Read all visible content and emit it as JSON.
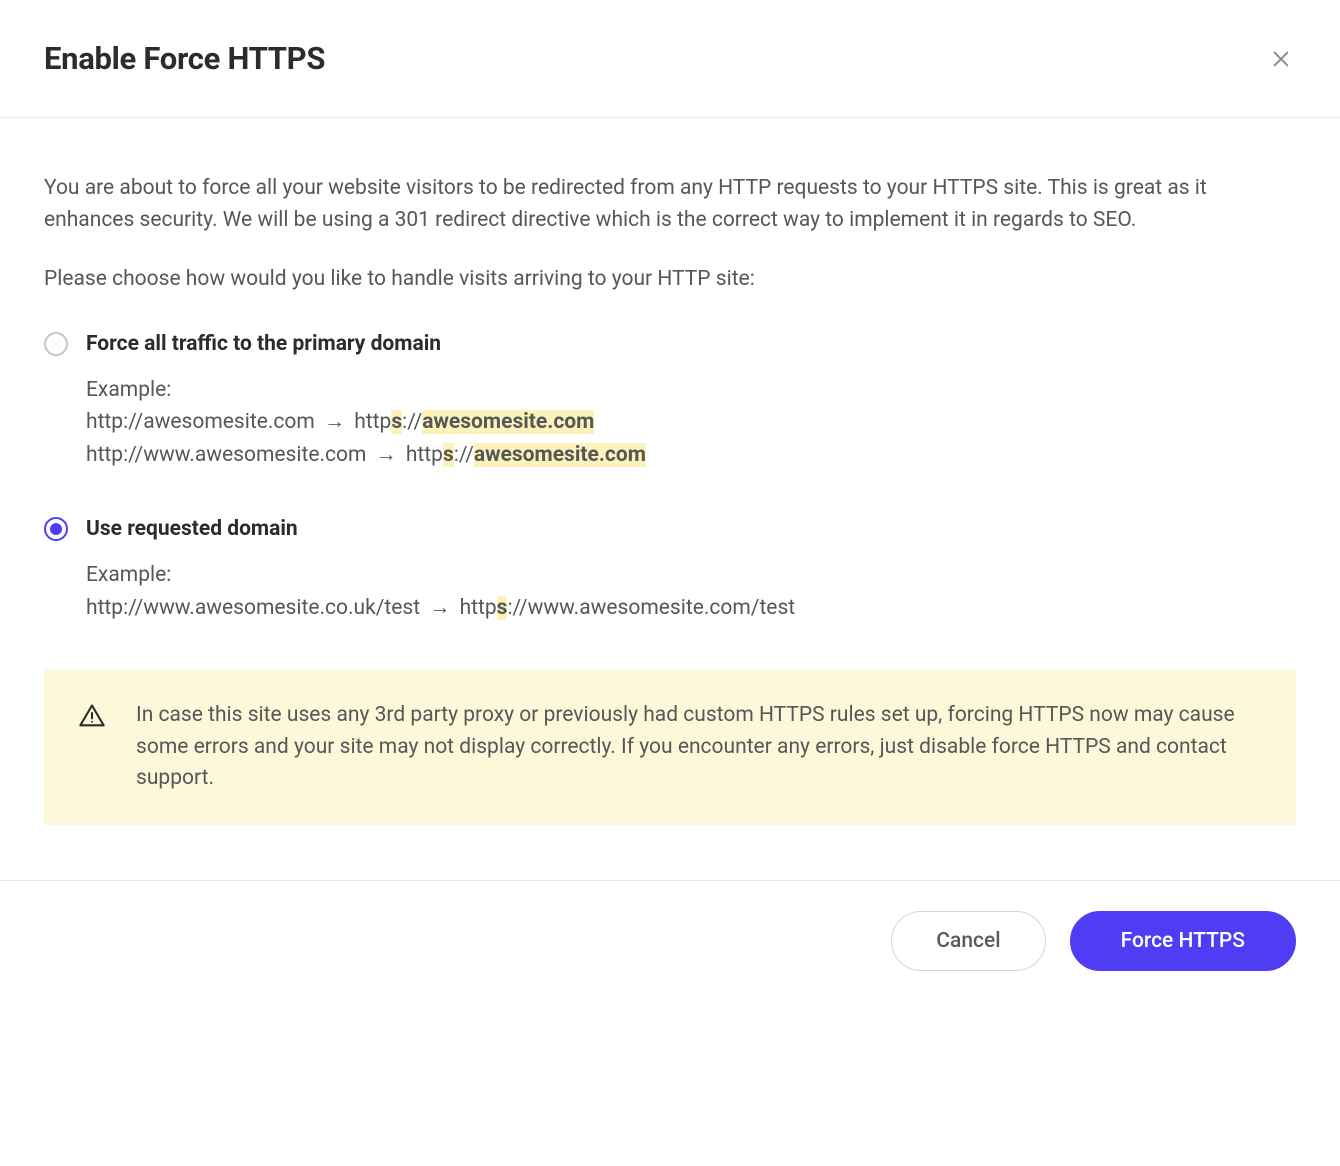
{
  "header": {
    "title": "Enable Force HTTPS"
  },
  "body": {
    "intro": "You are about to force all your website visitors to be redirected from any HTTP requests to your HTTPS site. This is great as it enhances security. We will be using a 301 redirect directive which is the correct way to implement it in regards to SEO.",
    "choose": "Please choose how would you like to handle visits arriving to your HTTP site:",
    "option1": {
      "label": "Force all traffic to the primary domain",
      "example_label": "Example:",
      "line1_from": "http://awesomesite.com",
      "line1_to_prefix": "http",
      "line1_to_s": "s",
      "line1_to_colon": "://",
      "line1_to_domain": "awesomesite.com",
      "line2_from": "http://www.awesomesite.com",
      "line2_to_prefix": "http",
      "line2_to_s": "s",
      "line2_to_colon": "://",
      "line2_to_domain": "awesomesite.com"
    },
    "option2": {
      "label": "Use requested domain",
      "example_label": "Example:",
      "line1_from": "http://www.awesomesite.co.uk/test",
      "line1_to_prefix": "http",
      "line1_to_s": "s",
      "line1_to_rest": "://www.awesomesite.com/test"
    },
    "warning": "In case this site uses any 3rd party proxy or previously had custom HTTPS rules set up, forcing HTTPS now may cause some errors and your site may not display correctly. If you encounter any errors, just disable force HTTPS and contact support."
  },
  "footer": {
    "cancel_label": "Cancel",
    "submit_label": "Force HTTPS"
  },
  "arrow_glyph": "→"
}
